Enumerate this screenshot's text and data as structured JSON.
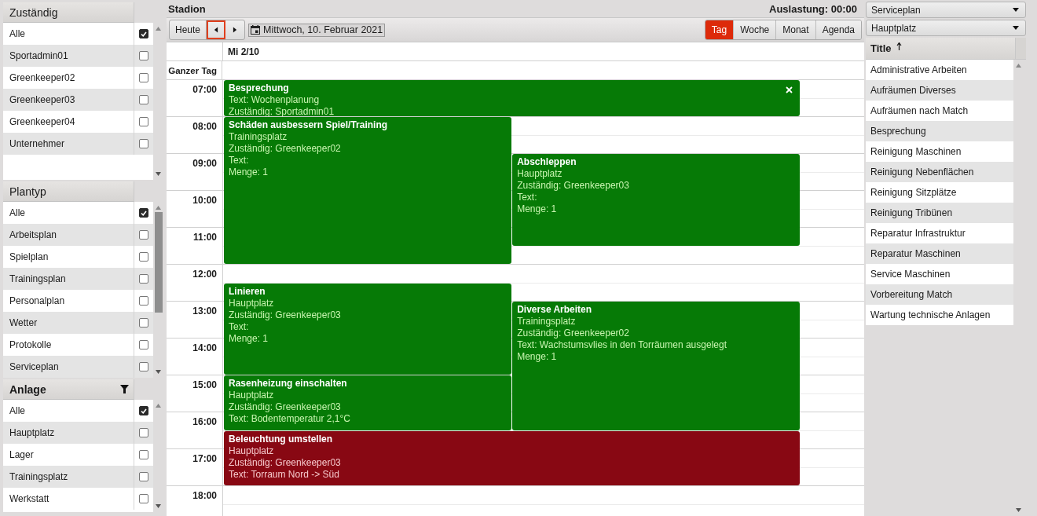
{
  "filters": [
    {
      "title": "Zuständig",
      "filtered": false,
      "items": [
        {
          "label": "Alle",
          "checked": true
        },
        {
          "label": "Sportadmin01",
          "checked": false
        },
        {
          "label": "Greenkeeper02",
          "checked": false
        },
        {
          "label": "Greenkeeper03",
          "checked": false
        },
        {
          "label": "Greenkeeper04",
          "checked": false
        },
        {
          "label": "Unternehmer",
          "checked": false
        }
      ]
    },
    {
      "title": "Plantyp",
      "filtered": false,
      "items": [
        {
          "label": "Alle",
          "checked": true
        },
        {
          "label": "Arbeitsplan",
          "checked": false
        },
        {
          "label": "Spielplan",
          "checked": false
        },
        {
          "label": "Trainingsplan",
          "checked": false
        },
        {
          "label": "Personalplan",
          "checked": false
        },
        {
          "label": "Wetter",
          "checked": false
        },
        {
          "label": "Protokolle",
          "checked": false
        },
        {
          "label": "Serviceplan",
          "checked": false
        }
      ]
    },
    {
      "title": "Anlage",
      "filtered": true,
      "items": [
        {
          "label": "Alle",
          "checked": true
        },
        {
          "label": "Hauptplatz",
          "checked": false
        },
        {
          "label": "Lager",
          "checked": false
        },
        {
          "label": "Trainingsplatz",
          "checked": false
        },
        {
          "label": "Werkstatt",
          "checked": false
        }
      ]
    }
  ],
  "calendar": {
    "title": "Stadion",
    "utilization": "Auslastung: 00:00",
    "today_button": "Heute",
    "nav_buttons": [
      {
        "kind": "prev",
        "focused": true
      },
      {
        "kind": "next",
        "focused": false
      }
    ],
    "date": "Mittwoch, 10. Februar 2021",
    "views": [
      {
        "label": "Tag",
        "selected": true
      },
      {
        "label": "Woche",
        "selected": false
      },
      {
        "label": "Monat",
        "selected": false
      },
      {
        "label": "Agenda",
        "selected": false
      }
    ],
    "day_header": "Mi 2/10",
    "all_day_label": "Ganzer Tag",
    "hours": [
      "07:00",
      "08:00",
      "09:00",
      "10:00",
      "11:00",
      "12:00",
      "13:00",
      "14:00",
      "15:00",
      "16:00",
      "17:00",
      "18:00"
    ],
    "events": [
      {
        "title": "Besprechung",
        "lines": [
          "Text: Wochenplanung",
          "Zuständig: Sportadmin01"
        ],
        "color": "#067a06",
        "closable": true
      },
      {
        "title": "Schäden ausbessern Spiel/Training",
        "lines": [
          "Trainingsplatz",
          "Zuständig: Greenkeeper02",
          "Text:",
          "Menge: 1"
        ],
        "color": "#067a06",
        "closable": false
      },
      {
        "title": "Abschleppen",
        "lines": [
          "Hauptplatz",
          "Zuständig: Greenkeeper03",
          "Text:",
          "Menge: 1"
        ],
        "color": "#067a06",
        "closable": false
      },
      {
        "title": "Linieren",
        "lines": [
          "Hauptplatz",
          "Zuständig: Greenkeeper03",
          "Text:",
          "Menge: 1"
        ],
        "color": "#067a06",
        "closable": false
      },
      {
        "title": "Diverse Arbeiten",
        "lines": [
          "Trainingsplatz",
          "Zuständig: Greenkeeper02",
          "Text: Wachstumsvlies in den Torräumen ausgelegt",
          "Menge: 1"
        ],
        "color": "#067a06",
        "closable": false
      },
      {
        "title": "Rasenheizung einschalten",
        "lines": [
          "Hauptplatz",
          "Zuständig: Greenkeeper03",
          "Text: Bodentemperatur 2,1°C"
        ],
        "color": "#067a06",
        "closable": false
      },
      {
        "title": "Beleuchtung umstellen",
        "lines": [
          "Hauptplatz",
          "Zuständig: Greenkeeper03",
          "Text: Torraum Nord -> Süd"
        ],
        "color": "#880813",
        "closable": false
      }
    ]
  },
  "templates": {
    "dropdowns": [
      "Serviceplan",
      "Hauptplatz"
    ],
    "column": "Title",
    "sorted_ascending": true,
    "rows": [
      "Administrative Arbeiten",
      "Aufräumen Diverses",
      "Aufräumen nach Match",
      "Besprechung",
      "Reinigung Maschinen",
      "Reinigung Nebenflächen",
      "Reinigung Sitzplätze",
      "Reinigung Tribünen",
      "Reparatur Infrastruktur",
      "Reparatur Maschinen",
      "Service Maschinen",
      "Vorbereitung Match",
      "Wartung technische Anlagen"
    ]
  }
}
